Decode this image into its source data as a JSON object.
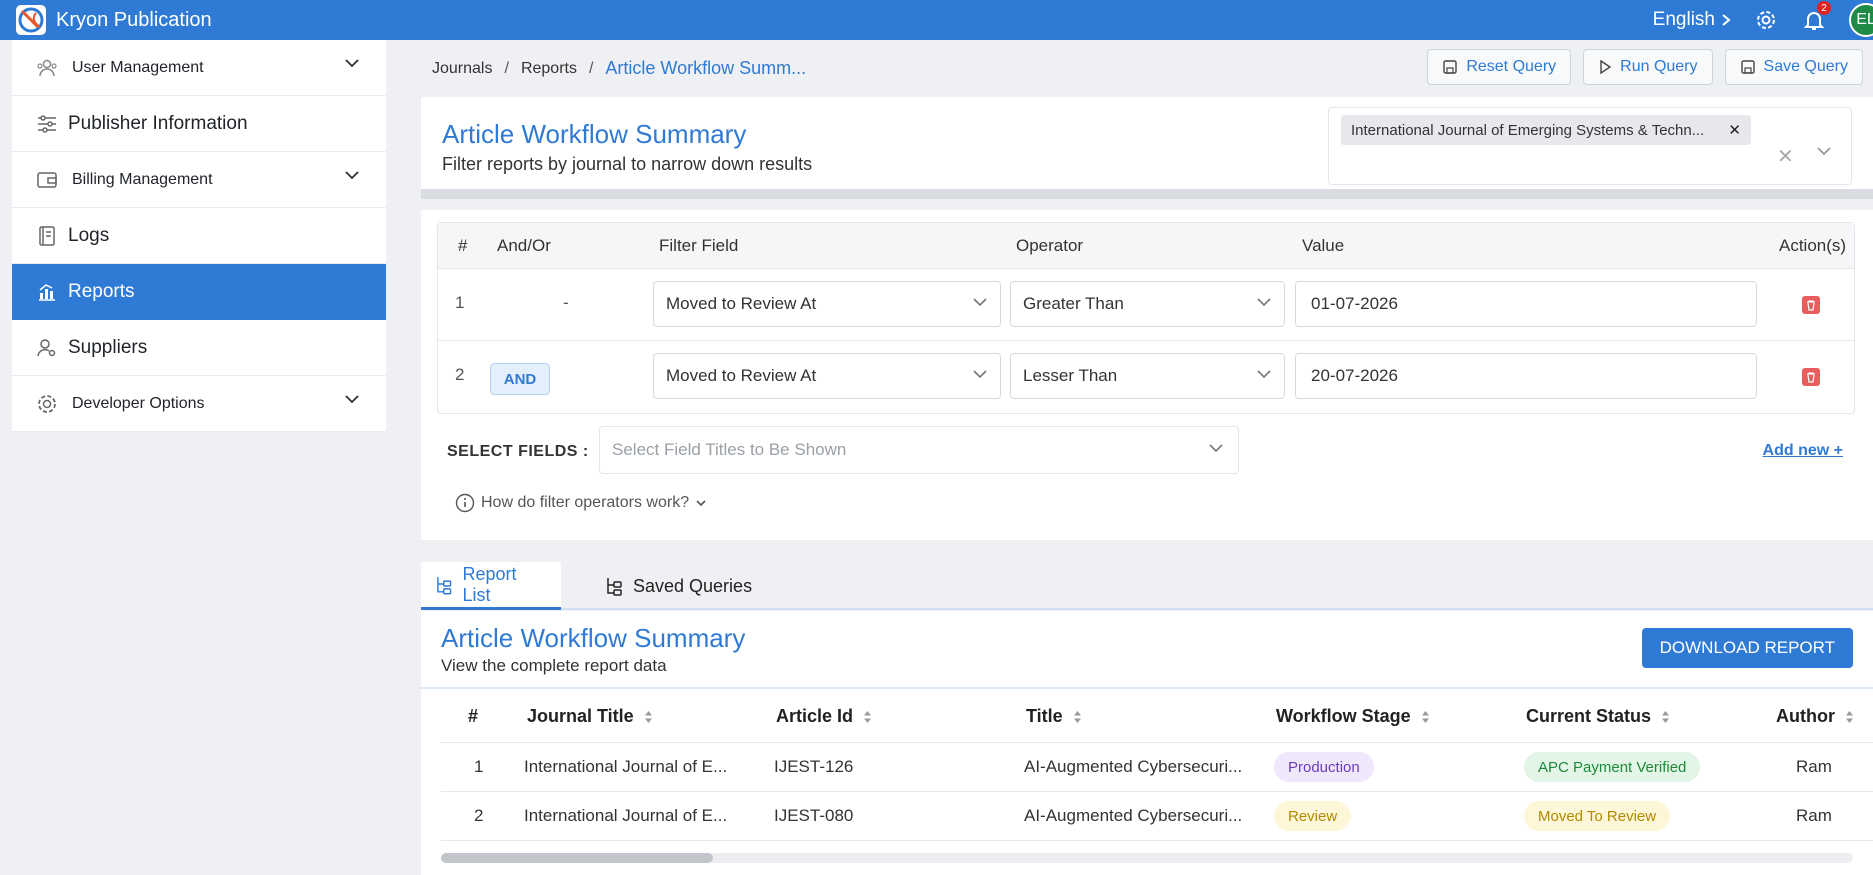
{
  "app": {
    "title": "Kryon Publication",
    "language": "English",
    "notifications": "2",
    "user_initials": "EL"
  },
  "sidebar": {
    "items": [
      {
        "label": "User Management",
        "icon": "users-icon"
      },
      {
        "label": "Publisher Information",
        "icon": "sliders-icon"
      },
      {
        "label": "Billing Management",
        "icon": "wallet-icon"
      },
      {
        "label": "Logs",
        "icon": "notebook-icon"
      },
      {
        "label": "Reports",
        "icon": "chart-icon"
      },
      {
        "label": "Suppliers",
        "icon": "user-gear-icon"
      },
      {
        "label": "Developer Options",
        "icon": "gear-icon"
      }
    ]
  },
  "breadcrumb": {
    "items": [
      "Journals",
      "Reports"
    ],
    "current": "Article Workflow Summ..."
  },
  "actions": {
    "reset": "Reset Query",
    "run": "Run Query",
    "save": "Save Query"
  },
  "query": {
    "title": "Article Workflow Summary",
    "subtitle": "Filter reports by journal to narrow down results",
    "journal_chip": "International Journal of Emerging Systems & Techn..."
  },
  "filters": {
    "headers": {
      "num": "#",
      "andor": "And/Or",
      "field": "Filter Field",
      "operator": "Operator",
      "value": "Value",
      "actions": "Action(s)"
    },
    "rows": [
      {
        "num": "1",
        "andor": "-",
        "field": "Moved to Review At",
        "operator": "Greater Than",
        "value": "01-07-2026"
      },
      {
        "num": "2",
        "andor": "AND",
        "field": "Moved to Review At",
        "operator": "Lesser Than",
        "value": "20-07-2026"
      }
    ],
    "select_fields_label": "SELECT FIELDS :",
    "select_fields_placeholder": "Select Field Titles to Be Shown",
    "add_new": "Add new +",
    "help": "How do filter operators work?"
  },
  "tabs": {
    "report_list": "Report List",
    "saved_queries": "Saved Queries"
  },
  "report": {
    "title": "Article Workflow Summary",
    "subtitle": "View the complete report data",
    "download": "DOWNLOAD REPORT",
    "columns": {
      "num": "#",
      "journal": "Journal Title",
      "article_id": "Article Id",
      "title": "Title",
      "stage": "Workflow Stage",
      "status": "Current Status",
      "author": "Author"
    },
    "rows": [
      {
        "num": "1",
        "journal": "International Journal of E...",
        "article_id": "IJEST-126",
        "title": "AI-Augmented Cybersecuri...",
        "stage": "Production",
        "status": "APC Payment Verified",
        "author": "Ram"
      },
      {
        "num": "2",
        "journal": "International Journal of E...",
        "article_id": "IJEST-080",
        "title": "AI-Augmented Cybersecuri...",
        "stage": "Review",
        "status": "Moved To Review",
        "author": "Ram"
      }
    ]
  },
  "colors": {
    "primary": "#2f7ad4",
    "production_bg": "#efe7fb",
    "production_fg": "#6a3fb5",
    "review_bg": "#fdf6d8",
    "review_fg": "#b08a00",
    "verified_bg": "#e2f5e6",
    "verified_fg": "#1f8a3a",
    "moved_bg": "#fdf6d8",
    "moved_fg": "#b08a00",
    "danger": "#ea5d5d"
  }
}
